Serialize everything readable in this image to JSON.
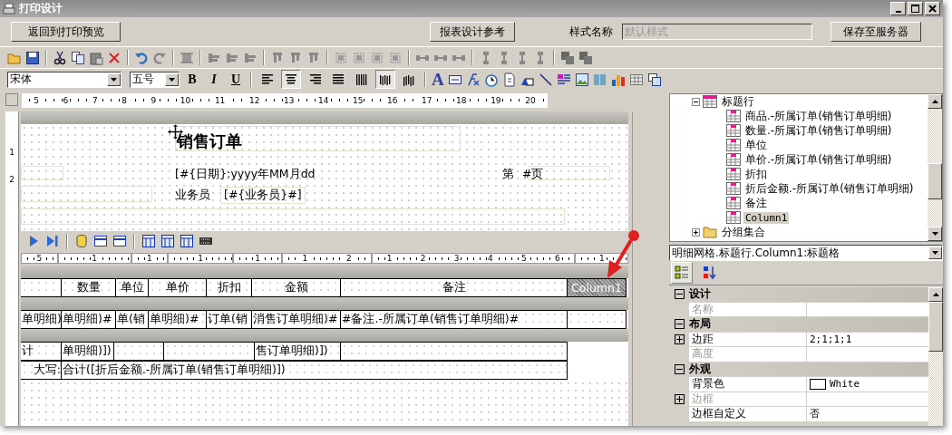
{
  "window": {
    "title": "打印设计"
  },
  "top_bar": {
    "back_button": "返回到打印预览",
    "reference_button": "报表设计参考",
    "style_label": "样式名称",
    "style_field": {
      "value": "默认样式",
      "disabled": true
    },
    "save_button": "保存至服务器"
  },
  "format_toolbar": {
    "font": "宋体",
    "size": "五号",
    "style_buttons": [
      "B",
      "I",
      "U"
    ],
    "text_tool": "A",
    "align_buttons": [
      {
        "selected": false
      },
      {
        "selected": true
      },
      {
        "selected": false
      },
      {
        "selected": false
      },
      {
        "selected": false
      },
      {
        "selected": true
      },
      {
        "selected": false
      }
    ]
  },
  "ruler": [
    "5",
    "6",
    "7",
    "8",
    "9",
    "10",
    "11",
    "12",
    "13",
    "14",
    "15",
    "16",
    "17",
    "18",
    "19",
    "20"
  ],
  "side_ruler": [
    "1",
    "2"
  ],
  "page_header": {
    "title": "销售订单",
    "date_field": "[#{日期}:yyyy年MM月dd",
    "page_label": "第",
    "page_field": "#页",
    "salesperson_label": "业务员",
    "salesperson_field": "[#{业务员}#]"
  },
  "column_ruler": [
    [
      "5"
    ],
    [
      "1"
    ],
    [
      "1"
    ],
    [
      "1"
    ],
    [
      "1"
    ],
    [
      "1",
      "2"
    ],
    [
      "1",
      "2",
      "3",
      "4",
      "5",
      "6"
    ],
    [
      "1"
    ]
  ],
  "detail_grid": {
    "header_row": [
      {
        "text": "数量",
        "selected": false
      },
      {
        "text": "单位",
        "selected": false
      },
      {
        "text": "单价",
        "selected": false
      },
      {
        "text": "折扣",
        "selected": false
      },
      {
        "text": "金额",
        "selected": false
      },
      {
        "text": "备注",
        "selected": false
      },
      {
        "text": "Column1",
        "selected": true
      }
    ],
    "data_row": [
      "单明细)",
      "单明细)#",
      "单(销",
      "单明细)#",
      "订单(销",
      "消售订单明细)#",
      "#备注.-所属订单(销售订单明细)#"
    ],
    "footer_rows": [
      [
        "计",
        "单明细)])",
        "售订单明细)])"
      ],
      [
        "大写:",
        "合计([折后金额.-所属订单(销售订单明细)])"
      ]
    ]
  },
  "tree": [
    {
      "label": "标题行",
      "expanded": true,
      "children": [
        {
          "label": "商品.-所属订单(销售订单明细)",
          "selected": false
        },
        {
          "label": "数量.-所属订单(销售订单明细)",
          "selected": false
        },
        {
          "label": "单位",
          "selected": false
        },
        {
          "label": "单价.-所属订单(销售订单明细)",
          "selected": false
        },
        {
          "label": "折扣",
          "selected": false
        },
        {
          "label": "折后金额.-所属订单(销售订单明细)",
          "selected": false
        },
        {
          "label": "备注",
          "selected": false
        },
        {
          "label": "Column1",
          "selected": true
        }
      ]
    },
    {
      "label": "分组集合",
      "expanded": false
    }
  ],
  "object_selector": "明细网格.标题行.Column1:标题格",
  "view_buttons": [
    {
      "selected": true
    },
    {
      "selected": false
    }
  ],
  "property_sections": [
    {
      "name": "设计",
      "expanded": true,
      "rows": [
        {
          "name": "名称",
          "kind": "text",
          "disabled": true,
          "expandable": false
        }
      ]
    },
    {
      "name": "布局",
      "expanded": true,
      "rows": [
        {
          "name": "边距",
          "value": "2;1;1;1",
          "kind": "text",
          "disabled": false,
          "expandable": true
        },
        {
          "name": "高度",
          "kind": "text",
          "disabled": true,
          "expandable": false
        }
      ]
    },
    {
      "name": "外观",
      "expanded": true,
      "rows": [
        {
          "name": "背景色",
          "value": "White",
          "kind": "color",
          "disabled": false,
          "expandable": false
        },
        {
          "name": "边框",
          "kind": "text",
          "disabled": true,
          "expandable": true
        },
        {
          "name": "边框自定义",
          "value": "否",
          "kind": "text",
          "disabled": false,
          "expandable": false
        }
      ]
    }
  ]
}
